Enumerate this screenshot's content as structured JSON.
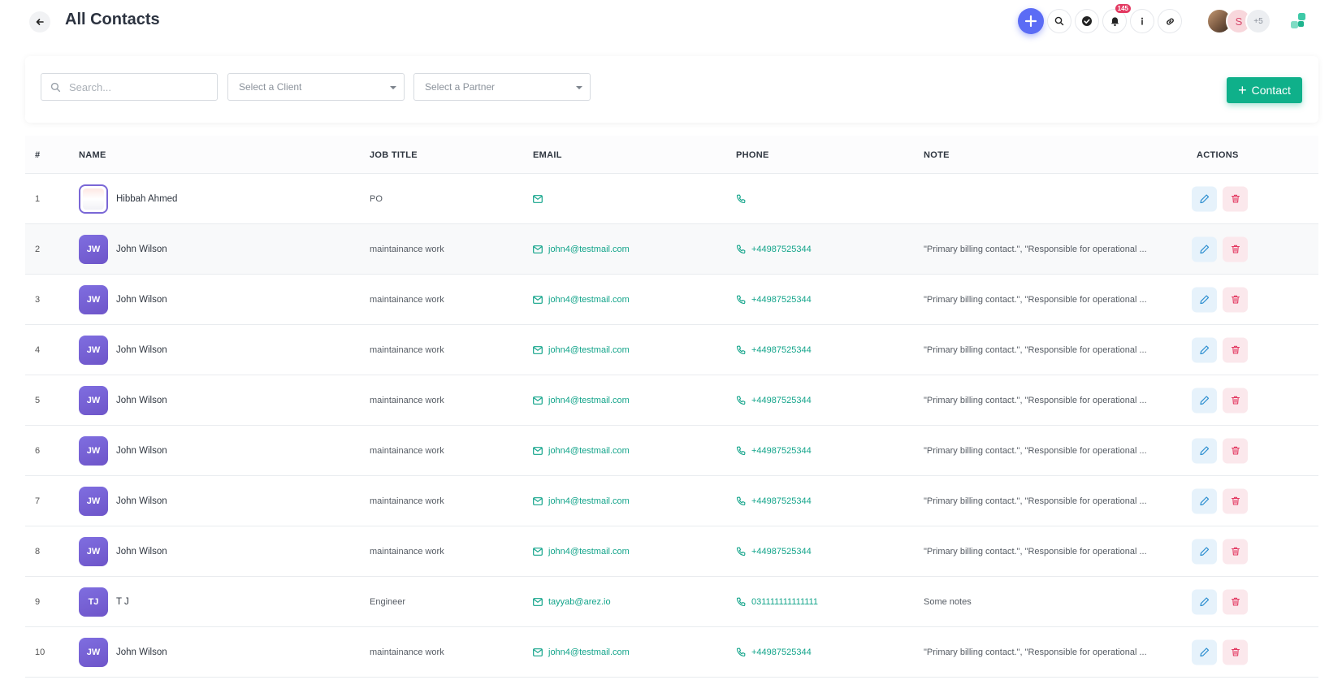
{
  "header": {
    "title": "All Contacts",
    "notification_count": "145",
    "avatar_initial": "S",
    "avatar_more": "+5"
  },
  "filters": {
    "search_placeholder": "Search...",
    "client_select": "Select a Client",
    "partner_select": "Select a Partner",
    "add_button": "Contact"
  },
  "table": {
    "columns": [
      "#",
      "NAME",
      "JOB TITLE",
      "EMAIL",
      "PHONE",
      "NOTE",
      "ACTIONS"
    ],
    "rows": [
      {
        "num": "1",
        "initials": "",
        "name": "Hibbah Ahmed",
        "job": "PO",
        "email": "",
        "phone": "",
        "note": ""
      },
      {
        "num": "2",
        "initials": "JW",
        "name": "John Wilson",
        "job": "maintainance work",
        "email": "john4@testmail.com",
        "phone": "+44987525344",
        "note": "\"Primary billing contact.\", \"Responsible for operational ..."
      },
      {
        "num": "3",
        "initials": "JW",
        "name": "John Wilson",
        "job": "maintainance work",
        "email": "john4@testmail.com",
        "phone": "+44987525344",
        "note": "\"Primary billing contact.\", \"Responsible for operational ..."
      },
      {
        "num": "4",
        "initials": "JW",
        "name": "John Wilson",
        "job": "maintainance work",
        "email": "john4@testmail.com",
        "phone": "+44987525344",
        "note": "\"Primary billing contact.\", \"Responsible for operational ..."
      },
      {
        "num": "5",
        "initials": "JW",
        "name": "John Wilson",
        "job": "maintainance work",
        "email": "john4@testmail.com",
        "phone": "+44987525344",
        "note": "\"Primary billing contact.\", \"Responsible for operational ..."
      },
      {
        "num": "6",
        "initials": "JW",
        "name": "John Wilson",
        "job": "maintainance work",
        "email": "john4@testmail.com",
        "phone": "+44987525344",
        "note": "\"Primary billing contact.\", \"Responsible for operational ..."
      },
      {
        "num": "7",
        "initials": "JW",
        "name": "John Wilson",
        "job": "maintainance work",
        "email": "john4@testmail.com",
        "phone": "+44987525344",
        "note": "\"Primary billing contact.\", \"Responsible for operational ..."
      },
      {
        "num": "8",
        "initials": "JW",
        "name": "John Wilson",
        "job": "maintainance work",
        "email": "john4@testmail.com",
        "phone": "+44987525344",
        "note": "\"Primary billing contact.\", \"Responsible for operational ..."
      },
      {
        "num": "9",
        "initials": "TJ",
        "name": "T J",
        "job": "Engineer",
        "email": "tayyab@arez.io",
        "phone": "031111111111111",
        "note": "Some notes"
      },
      {
        "num": "10",
        "initials": "JW",
        "name": "John Wilson",
        "job": "maintainance work",
        "email": "john4@testmail.com",
        "phone": "+44987525344",
        "note": "\"Primary billing contact.\", \"Responsible for operational ..."
      }
    ]
  },
  "colors": {
    "primary": "#5b6cf5",
    "accent_green": "#0fb08a",
    "link_green": "#12a48a",
    "danger": "#e33a62",
    "avatar_purple": "#7461d6"
  },
  "icons": [
    "back-arrow-icon",
    "plus-icon",
    "search-icon",
    "check-circle-icon",
    "bell-icon",
    "info-icon",
    "link-icon",
    "logo-icon",
    "mail-icon",
    "phone-icon",
    "pencil-icon",
    "trash-icon",
    "caret-down-icon"
  ]
}
